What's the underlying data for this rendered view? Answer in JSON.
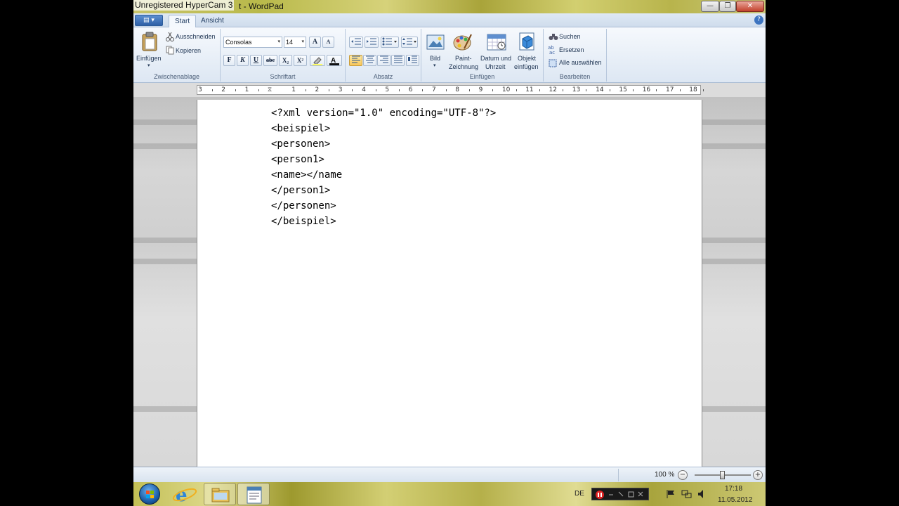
{
  "window": {
    "overlay_title": "Unregistered HyperCam 3",
    "title_suffix": "t - WordPad",
    "min_symbol": "—",
    "max_symbol": "❐",
    "close_symbol": "✕"
  },
  "tabs": [
    {
      "label": "Start",
      "active": true
    },
    {
      "label": "Ansicht",
      "active": false
    }
  ],
  "help_symbol": "?",
  "clipboard": {
    "paste_label": "Einfügen",
    "cut_label": "Ausschneiden",
    "copy_label": "Kopieren",
    "group_label": "Zwischenablage"
  },
  "font": {
    "family_value": "Consolas",
    "size_value": "14",
    "grow_label": "A",
    "shrink_label": "A",
    "bold_label": "F",
    "italic_label": "K",
    "underline_label": "U",
    "strike_label": "abc",
    "sub_label": "X₂",
    "sup_label": "X²",
    "group_label": "Schriftart"
  },
  "paragraph": {
    "group_label": "Absatz"
  },
  "insert": {
    "picture_label": "Bild",
    "paint_label_1": "Paint-",
    "paint_label_2": "Zeichnung",
    "datetime_label_1": "Datum und",
    "datetime_label_2": "Uhrzeit",
    "object_label_1": "Objekt",
    "object_label_2": "einfügen",
    "group_label": "Einfügen"
  },
  "editing": {
    "find_label": "Suchen",
    "replace_label": "Ersetzen",
    "select_all_label": "Alle auswählen",
    "group_label": "Bearbeiten"
  },
  "ruler": {
    "labels": [
      "3",
      "2",
      "1",
      "1",
      "2",
      "3",
      "4",
      "5",
      "6",
      "7",
      "8",
      "9",
      "10",
      "11",
      "12",
      "13",
      "14",
      "15",
      "16",
      "17",
      "18"
    ]
  },
  "document": {
    "lines": [
      "<?xml version=\"1.0\" encoding=\"UTF-8\"?>",
      "<beispiel>",
      "<personen>",
      "<person1>",
      "<name></name",
      "</person1>",
      "</personen>",
      "</beispiel>"
    ]
  },
  "status": {
    "zoom_text": "100 %",
    "zoom_minus": "−",
    "zoom_plus": "+",
    "zoom_level": 0.5
  },
  "taskbar": {
    "lang": "DE",
    "time": "17:18",
    "date": "11.05.2012"
  },
  "colors": {
    "ribbon_accent": "#3d74c0",
    "wallpaper": "#c2bf55",
    "close_button": "#c2412c"
  },
  "icons": [
    "paste-icon",
    "cut-icon",
    "copy-icon",
    "picture-icon",
    "paint-icon",
    "calendar-icon",
    "object-icon",
    "binoculars-icon",
    "replace-icon",
    "select-all-icon",
    "ie-icon",
    "explorer-icon",
    "wordpad-icon",
    "flag-icon",
    "network-icon",
    "speaker-icon"
  ]
}
